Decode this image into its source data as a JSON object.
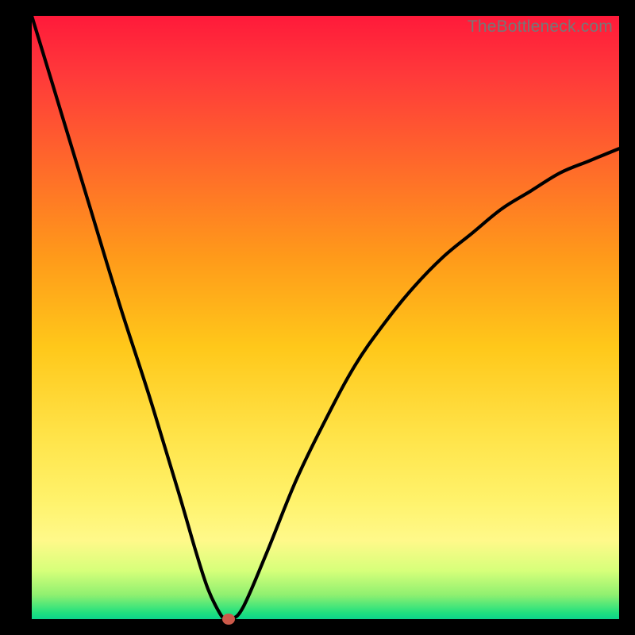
{
  "watermark": "TheBottleneck.com",
  "chart_data": {
    "type": "line",
    "title": "",
    "xlabel": "",
    "ylabel": "",
    "xlim": [
      0,
      100
    ],
    "ylim": [
      0,
      100
    ],
    "series": [
      {
        "name": "curve",
        "x": [
          0,
          5,
          10,
          15,
          20,
          25,
          28,
          30,
          32,
          33,
          34,
          36,
          40,
          45,
          50,
          55,
          60,
          65,
          70,
          75,
          80,
          85,
          90,
          95,
          100
        ],
        "y": [
          100,
          84,
          68,
          52,
          37,
          21,
          11,
          5,
          1,
          0,
          0,
          2,
          11,
          23,
          33,
          42,
          49,
          55,
          60,
          64,
          68,
          71,
          74,
          76,
          78
        ]
      }
    ],
    "background_gradient": {
      "top": "#ff1a3a",
      "mid_upper": "#ff9a1a",
      "mid": "#ffe44a",
      "mid_lower": "#d6ff7a",
      "bottom": "#0cd48b"
    },
    "marker": {
      "x": 33.5,
      "y": 0,
      "color": "#cc5a4a"
    }
  }
}
